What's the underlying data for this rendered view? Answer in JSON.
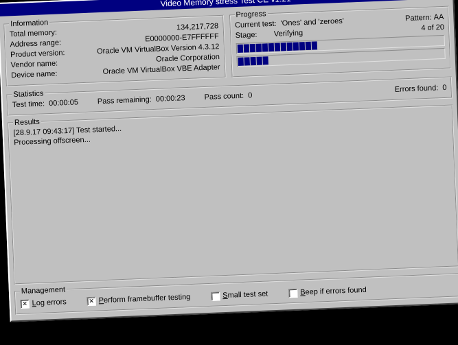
{
  "title": "Video Memory stress Test CE v1.21",
  "information": {
    "legend": "Information",
    "total_memory_label": "Total memory:",
    "total_memory_value": "134,217,728",
    "address_range_label": "Address range:",
    "address_range_value": "E0000000-E7FFFFFF",
    "product_version_label": "Product version:",
    "product_version_value": "Oracle VM VirtualBox Version 4.3.12",
    "vendor_name_label": "Vendor name:",
    "vendor_name_value": "Oracle Corporation",
    "device_name_label": "Device name:",
    "device_name_value": "Oracle VM VirtualBox VBE Adapter"
  },
  "progress": {
    "legend": "Progress",
    "current_test_label": "Current test:",
    "current_test_value": "'Ones' and 'zeroes'",
    "pattern_label": "Pattern:",
    "pattern_value": "AA",
    "stage_label": "Stage:",
    "stage_value": "Verifying",
    "count_value": "4 of 20",
    "bar1_segments": 13,
    "bar2_segments": 5
  },
  "statistics": {
    "legend": "Statistics",
    "test_time_label": "Test time:",
    "test_time_value": "00:00:05",
    "pass_remaining_label": "Pass remaining:",
    "pass_remaining_value": "00:00:23",
    "pass_count_label": "Pass count:",
    "pass_count_value": "0",
    "errors_found_label": "Errors found:",
    "errors_found_value": "0"
  },
  "results": {
    "legend": "Results",
    "lines": "[28.9.17 09:43:17] Test started...\nProcessing offscreen..."
  },
  "management": {
    "legend": "Management",
    "log_errors": {
      "checked": true,
      "pre": "",
      "accel": "L",
      "post": "og errors"
    },
    "perform_fb": {
      "checked": true,
      "pre": "",
      "accel": "P",
      "post": "erform framebuffer testing"
    },
    "small_set": {
      "checked": false,
      "pre": "",
      "accel": "S",
      "post": "mall test set"
    },
    "beep": {
      "checked": false,
      "pre": "",
      "accel": "B",
      "post": "eep if errors found"
    }
  }
}
